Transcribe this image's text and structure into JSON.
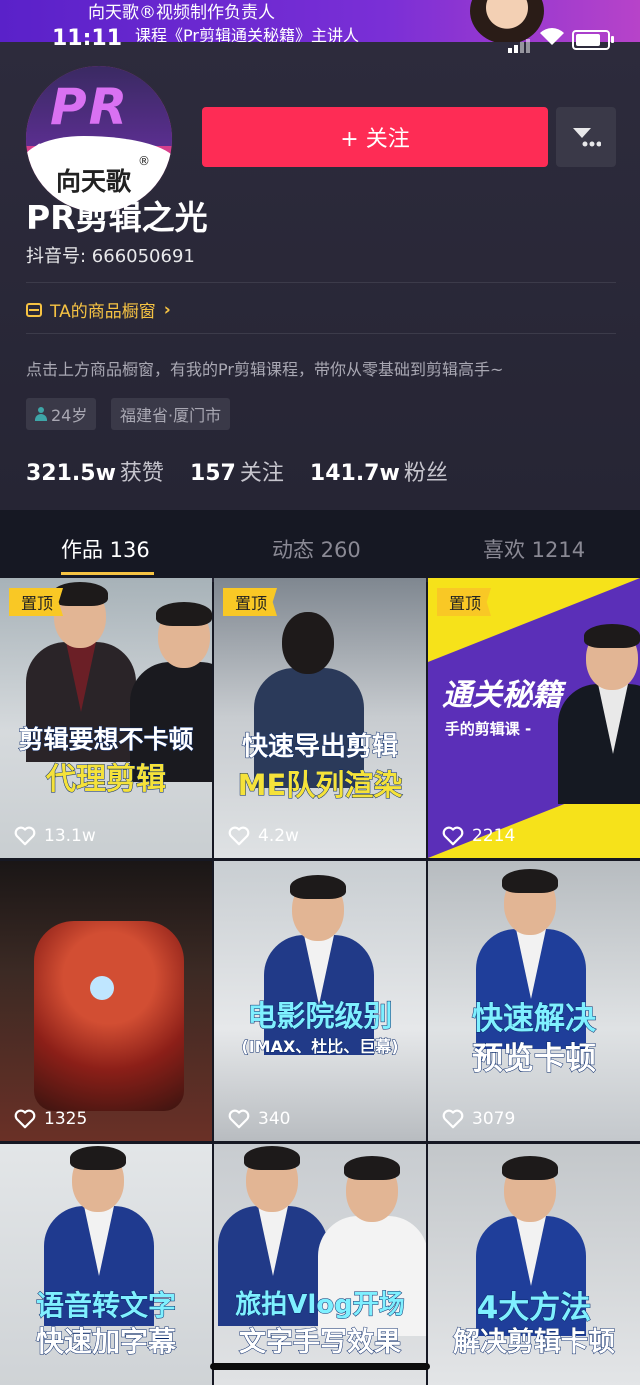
{
  "banner": {
    "line1": "向天歌®视频制作负责人",
    "line2": "课程《Pr剪辑通关秘籍》主讲人"
  },
  "status_bar": {
    "time": "11:11"
  },
  "avatar": {
    "logo_text": "PR",
    "brand_text": "向天歌",
    "reg_mark": "®"
  },
  "header": {
    "follow_label": "+ 关注"
  },
  "profile": {
    "nickname": "PR剪辑之光",
    "douyin_id": "抖音号: 666050691",
    "shop_window": "TA的商品橱窗",
    "bio": "点击上方商品橱窗，有我的Pr剪辑课程，带你从零基础到剪辑高手~",
    "tags": [
      "24岁",
      "福建省·厦门市"
    ]
  },
  "stats": [
    {
      "value": "321.5w",
      "label": "获赞"
    },
    {
      "value": "157",
      "label": "关注"
    },
    {
      "value": "141.7w",
      "label": "粉丝"
    }
  ],
  "tabs": [
    {
      "label": "作品 136",
      "active": true
    },
    {
      "label": "动态 260",
      "active": false
    },
    {
      "label": "喜欢 1214",
      "active": false
    }
  ],
  "videos": [
    {
      "pinned": "置顶",
      "caption1": "剪辑要想不卡顿",
      "caption2": "代理剪辑",
      "likes": "13.1w"
    },
    {
      "pinned": "置顶",
      "caption1": "快速导出剪辑",
      "caption2": "ME队列渲染",
      "likes": "4.2w"
    },
    {
      "pinned": "置顶",
      "caption1": "通关秘籍",
      "caption2": "手的剪辑课 -",
      "likes": "2214"
    },
    {
      "pinned": "",
      "caption1": "",
      "caption2": "",
      "likes": "1325"
    },
    {
      "pinned": "",
      "caption1": "电影院级别",
      "caption2": "(IMAX、杜比、巨幕)",
      "likes": "340"
    },
    {
      "pinned": "",
      "caption1": "快速解决",
      "caption2": "预览卡顿",
      "likes": "3079"
    },
    {
      "pinned": "",
      "caption1": "语音转文字",
      "caption2": "快速加字幕",
      "likes": ""
    },
    {
      "pinned": "",
      "caption1": "旅拍Vlog开场",
      "caption2": "文字手写效果",
      "likes": ""
    },
    {
      "pinned": "",
      "caption1": "4大方法",
      "caption2": "解决剪辑卡顿",
      "likes": ""
    }
  ],
  "colors": {
    "accent": "#fe2c55",
    "background": "#161823",
    "profile_bg": "#2d2b3c",
    "shop_yellow": "#f6c343",
    "badge_yellow": "#f9c825"
  }
}
